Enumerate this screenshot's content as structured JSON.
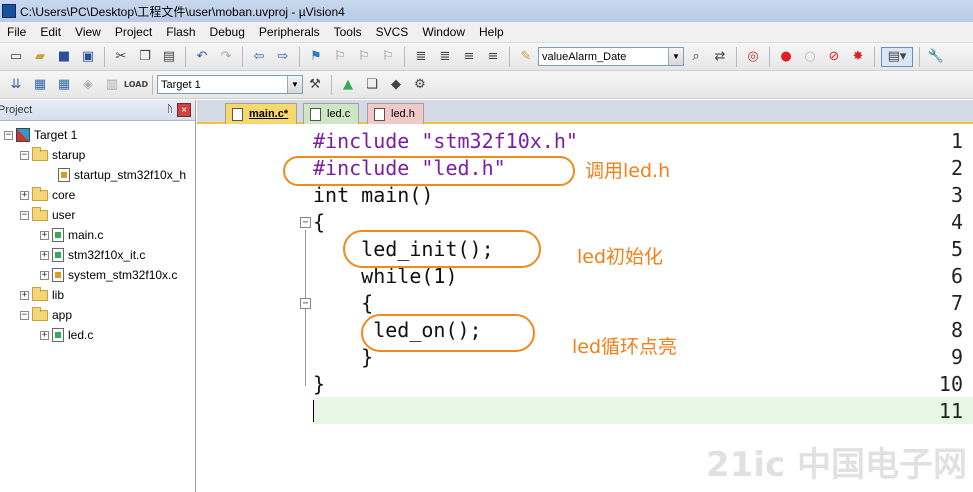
{
  "window": {
    "title": "C:\\Users\\PC\\Desktop\\工程文件\\user\\moban.uvproj - µVision4"
  },
  "menu": [
    "File",
    "Edit",
    "View",
    "Project",
    "Flash",
    "Debug",
    "Peripherals",
    "Tools",
    "SVCS",
    "Window",
    "Help"
  ],
  "toolbar": {
    "find_combo_value": "valueAlarm_Date",
    "target_combo_value": "Target 1"
  },
  "project_panel": {
    "header": "Project",
    "pin": "ᚢ",
    "close": "×",
    "tree": [
      {
        "label": "Target 1",
        "kind": "target",
        "expander": "−"
      },
      {
        "label": "starup",
        "kind": "folder",
        "expander": "−"
      },
      {
        "label": "startup_stm32f10x_h",
        "kind": "asm",
        "expander": ""
      },
      {
        "label": "core",
        "kind": "folder",
        "expander": "+"
      },
      {
        "label": "user",
        "kind": "folder",
        "expander": "−"
      },
      {
        "label": "main.c",
        "kind": "file",
        "expander": "+"
      },
      {
        "label": "stm32f10x_it.c",
        "kind": "file",
        "expander": "+"
      },
      {
        "label": "system_stm32f10x.c",
        "kind": "asm",
        "expander": "+"
      },
      {
        "label": "lib",
        "kind": "folder",
        "expander": "+"
      },
      {
        "label": "app",
        "kind": "folder",
        "expander": "−"
      },
      {
        "label": "led.c",
        "kind": "file",
        "expander": "+"
      }
    ]
  },
  "tabs": [
    {
      "label": "main.c*",
      "state": "active"
    },
    {
      "label": "led.c",
      "state": "inactive"
    },
    {
      "label": "led.h",
      "state": "inactive"
    }
  ],
  "editor": {
    "line_numbers": [
      "1",
      "2",
      "3",
      "4",
      "5",
      "6",
      "7",
      "8",
      "9",
      "10",
      "11"
    ],
    "lines": [
      "#include \"stm32f10x.h\"",
      "#include \"led.h\"",
      "int main()",
      "{",
      "    led_init();",
      "    while(1)",
      "    {",
      "     led_on();",
      "    }",
      "}",
      ""
    ]
  },
  "annotations": {
    "a1": "调用led.h",
    "a2": "led初始化",
    "a3": "led循环点亮"
  },
  "watermark": "21ic 中国电子网",
  "colors": {
    "annotation": "#f08a1c",
    "active_tab": "#f7d86a",
    "current_line": "#e6f7e6"
  }
}
